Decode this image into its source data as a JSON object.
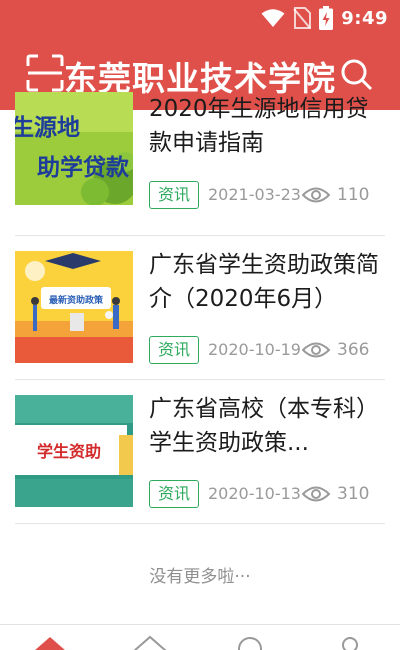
{
  "status_bar": {
    "time": "9:49",
    "icons": [
      "wifi-icon",
      "no-sim-icon",
      "battery-charging-icon"
    ]
  },
  "header": {
    "title": "东莞职业技术学院",
    "left_icon": "scan-icon",
    "right_icon": "search-icon"
  },
  "colors": {
    "brand": "#e0504a",
    "tag": "#2eaa5c",
    "meta_text": "#9a9a9a"
  },
  "articles": [
    {
      "title": "2020年生源地信用贷款申请指南",
      "tag": "资讯",
      "date": "2021-03-23",
      "views": "110",
      "thumb_text": [
        "生源地",
        "助学贷款"
      ]
    },
    {
      "title": "广东省学生资助政策简介（2020年6月）",
      "tag": "资讯",
      "date": "2020-10-19",
      "views": "366",
      "thumb_text": [
        "最新资助政策"
      ]
    },
    {
      "title": "广东省高校（本专科）学生资助政策...",
      "tag": "资讯",
      "date": "2020-10-13",
      "views": "310",
      "thumb_text": [
        "学生资助"
      ]
    }
  ],
  "list_footer": "没有更多啦···",
  "tab_bar": {
    "icons": [
      "home-icon",
      "discover-icon",
      "message-icon",
      "profile-icon"
    ]
  }
}
